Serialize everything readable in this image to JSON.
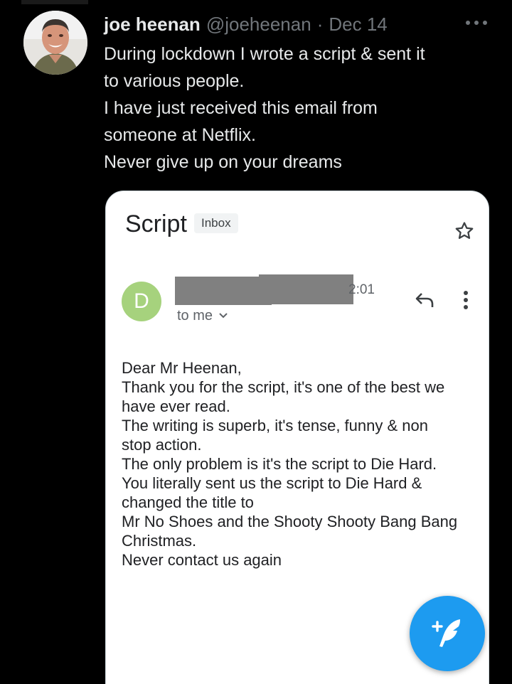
{
  "tweet": {
    "author_name": "joe heenan",
    "handle": "@joeheenan",
    "separator": "·",
    "date": "Dec 14",
    "text_lines": [
      "During lockdown I wrote a script & sent it",
      "to various people.",
      "I have just received this email from",
      "someone at Netflix.",
      "Never give up on your dreams"
    ]
  },
  "email": {
    "subject": "Script",
    "badge": "Inbox",
    "sender_initial": "D",
    "time_fragment": "2:01",
    "recipient": "to me",
    "body_lines": [
      "Dear Mr Heenan,",
      "Thank you for the script, it's one of the best we",
      "have ever read.",
      "The writing is superb, it's tense, funny & non",
      "stop action.",
      "The only problem is it's the script to Die Hard.",
      "You literally sent us the script to Die Hard &",
      "changed the title to",
      "Mr No Shoes and the Shooty Shooty Bang Bang",
      "Christmas.",
      "Never contact us again"
    ]
  },
  "colors": {
    "background": "#000000",
    "primary_text": "#e7e9ea",
    "secondary_text": "#71767b",
    "accent": "#1d9bf0",
    "avatar_green": "#a6d27d",
    "redaction_gray": "#808080"
  },
  "icons": {
    "more": "more-horizontal-icon",
    "star": "star-outline-icon",
    "reply": "reply-arrow-icon",
    "kebab": "more-vertical-icon",
    "compose": "compose-feather-icon"
  }
}
